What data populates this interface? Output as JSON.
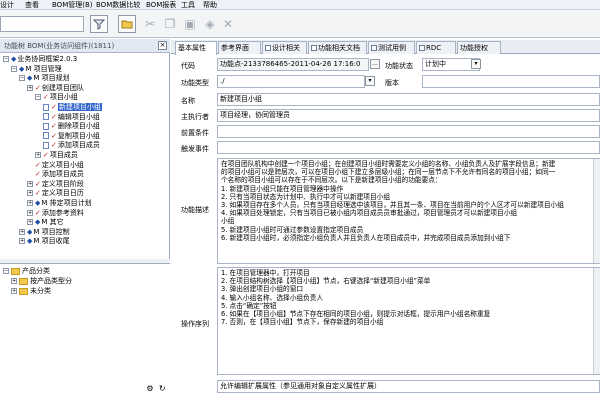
{
  "menubar": {
    "items": [
      "设计",
      "查看",
      "BOM管理(B)",
      "BOM数据比较",
      "BOM报表",
      "工具",
      "帮助"
    ]
  },
  "toolbar": {
    "search_value": ""
  },
  "left_panel": {
    "title": "功能树 BOM(业务访问组件)(1811)",
    "tree": [
      {
        "label": "业务协同框架2.0.3",
        "level": 0,
        "exp": "minus",
        "mark": "M"
      },
      {
        "label": "M 项目管理",
        "level": 1,
        "exp": "minus",
        "mark": "M"
      },
      {
        "label": "M 项目规划",
        "level": 2,
        "exp": "minus",
        "mark": "M"
      },
      {
        "label": "创建项目团队",
        "level": 3,
        "exp": "plus",
        "mark": "check"
      },
      {
        "label": "项目小组",
        "level": 4,
        "exp": "minus",
        "mark": "check"
      },
      {
        "label": "新建项目小组",
        "level": 5,
        "exp": "",
        "mark": "check",
        "doc": true,
        "selected": true
      },
      {
        "label": "编辑项目小组",
        "level": 5,
        "exp": "",
        "mark": "check",
        "doc": true
      },
      {
        "label": "删除项目小组",
        "level": 5,
        "exp": "",
        "mark": "check",
        "doc": true
      },
      {
        "label": "复制项目小组",
        "level": 5,
        "exp": "",
        "mark": "check",
        "doc": true
      },
      {
        "label": "添加项目成员",
        "level": 5,
        "exp": "",
        "mark": "check",
        "doc": true
      },
      {
        "label": "项目成员",
        "level": 4,
        "exp": "plus",
        "mark": "check"
      },
      {
        "label": "定义项目小组",
        "level": 4,
        "exp": "",
        "mark": "check"
      },
      {
        "label": "添加项目成员",
        "level": 4,
        "exp": "",
        "mark": "check"
      },
      {
        "label": "定义项目阶段",
        "level": 3,
        "exp": "plus",
        "mark": "check"
      },
      {
        "label": "定义项目日历",
        "level": 3,
        "exp": "plus",
        "mark": "check"
      },
      {
        "label": "M 排定项目计划",
        "level": 3,
        "exp": "plus",
        "mark": "M"
      },
      {
        "label": "添加参考资料",
        "level": 3,
        "exp": "plus",
        "mark": "check"
      },
      {
        "label": "M 其它",
        "level": 3,
        "exp": "plus",
        "mark": "M"
      },
      {
        "label": "M 项目控制",
        "level": 2,
        "exp": "plus",
        "mark": "M"
      },
      {
        "label": "M 项目收尾",
        "level": 2,
        "exp": "plus",
        "mark": "M"
      }
    ],
    "tree2": [
      {
        "label": "产品分类",
        "level": 0,
        "exp": "minus"
      },
      {
        "label": "按产品类型分",
        "level": 1,
        "exp": "plus"
      },
      {
        "label": "未分类",
        "level": 1,
        "exp": "plus"
      }
    ]
  },
  "tabs": [
    {
      "label": "基本属性",
      "active": true
    },
    {
      "label": "参考界面",
      "active": false
    },
    {
      "label": "设计相关",
      "active": false
    },
    {
      "label": "功能相关文档",
      "active": false
    },
    {
      "label": "测试用例",
      "active": false
    },
    {
      "label": "RDC",
      "active": false
    },
    {
      "label": "功能授权",
      "active": false
    }
  ],
  "form": {
    "code_label": "代码",
    "code_value": "功能点-2133786465-2011-04-26 17:16:0",
    "status_label": "功能状态",
    "status_value": "计划中",
    "type_label": "功能类型",
    "type_value": "./",
    "version_label": "版本",
    "version_value": "",
    "name_label": "名称",
    "name_value": "新建项目小组",
    "executor_label": "主执行者",
    "executor_value": "项目经理，协同管理员",
    "precondition_label": "前置条件",
    "precondition_value": "",
    "trigger_label": "触发事件",
    "trigger_value": "",
    "desc_label": "功能描述",
    "description": [
      "在项目团队机构中创建一个项目小组；在创建项目小组时需要定义小组的名称、小组负责人及扩展字段信息；新建",
      "的项目小组可以是跨层次，可以在项目小组下建立多层级小组；在同一层节点下不允许有同名的项目小组；如同一",
      "个名称的项目小组可以存在于不同层次。以下是新建项目小组的功能要点：",
      "1. 新建项目小组只能在项目管理器中操作",
      "2. 只有当项目状态为计划中、执行中才可以新建项目小组",
      "3. 如果项目存在多个人员，只有当项目经理选中该项目，并且其一条、项目在当前用户的个人区才可以新建项目小组",
      "4. 如果项目处理锁定，只有当项目已被小组内项目成员员审批通过，项目管理员才可以新建项目小组",
      "   小组",
      "5. 新建项目小组时可通过参数设置指定项目成员",
      "6. 新建项目小组时，必须指定小组负责人并且负责人在项目成员中，并完成项目成员添加到小组下"
    ],
    "steps_label": "操作序列",
    "steps": [
      "1. 在项目管理器中，打开项目",
      "2. 在项目结构树选择【项目小组】节点，右键选择“新建项目小组”菜单",
      "3. 弹出创建项目小组的窗口",
      "4. 输入小组名称、选择小组负责人",
      "5. 点击“确定”按钮",
      "6. 如果在【项目小组】节点下存在相同的项目小组，则提示对话框，提示用户小组名称重复",
      "7. 否则，在【项目小组】节点下，保存新建的项目小组"
    ],
    "remark_value": "允许编辑扩展属性（参见通用对象自定义属性扩展）"
  }
}
